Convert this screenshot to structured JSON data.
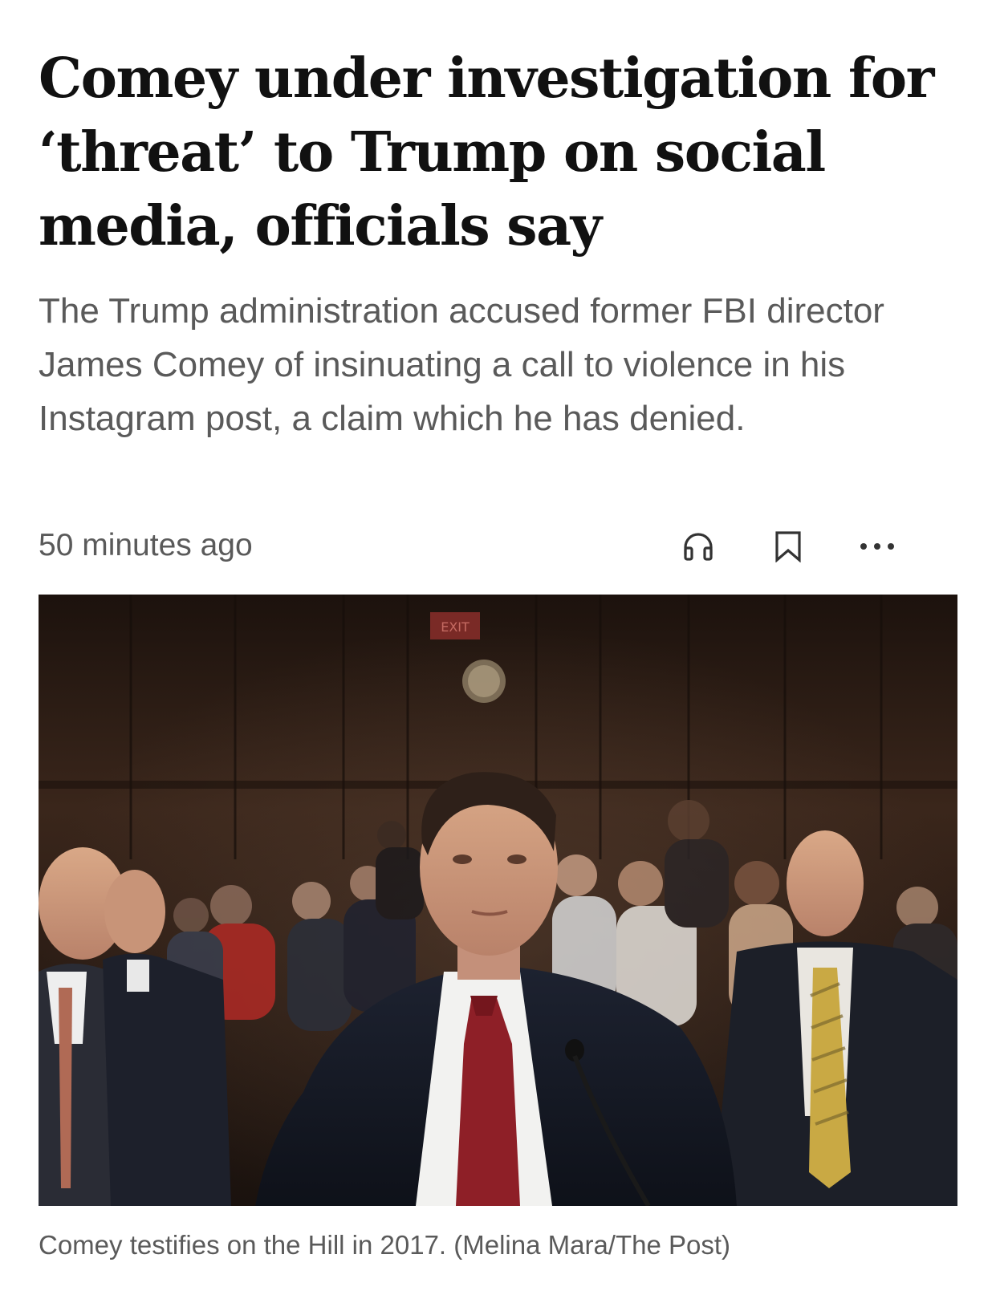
{
  "article": {
    "headline": "Comey under investigation for ‘threat’ to Trump on social media, officials say",
    "dek": "The Trump administration accused former FBI director James Comey of insinuating a call to violence in his Instagram post, a claim which he has denied.",
    "timestamp": "50 minutes ago",
    "actions": [
      {
        "name": "listen",
        "icon": "headphones-icon"
      },
      {
        "name": "save",
        "icon": "bookmark-icon"
      },
      {
        "name": "more",
        "icon": "more-horizontal-icon"
      }
    ],
    "photo": {
      "caption": "Comey testifies on the Hill in 2017. (Melina Mara/The Post)",
      "exit_sign": "EXIT"
    }
  },
  "colors": {
    "headline_text": "#111111",
    "secondary_text": "#5a5a5a",
    "icon": "#333333",
    "background": "#ffffff"
  }
}
